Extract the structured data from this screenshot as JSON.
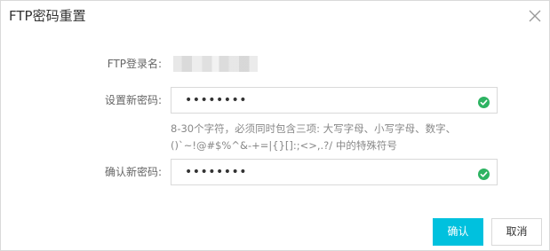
{
  "dialog": {
    "title": "FTP密码重置",
    "close_icon": "close-icon"
  },
  "form": {
    "login_label": "FTP登录名:",
    "new_password_label": "设置新密码:",
    "new_password_value": "••••••••",
    "hint_line1": "8-30个字符，必须同时包含三项: 大写字母、小写字母、数字、",
    "hint_line2": "()`~!@#$%^&-+=|{}[]:;<>,.?/ 中的特殊符号",
    "confirm_password_label": "确认新密码:",
    "confirm_password_value": "••••••••",
    "valid_icon": "check-circle-icon",
    "valid_color": "#2db362"
  },
  "buttons": {
    "ok_label": "确认",
    "cancel_label": "取消",
    "accent": "#00c1de"
  }
}
